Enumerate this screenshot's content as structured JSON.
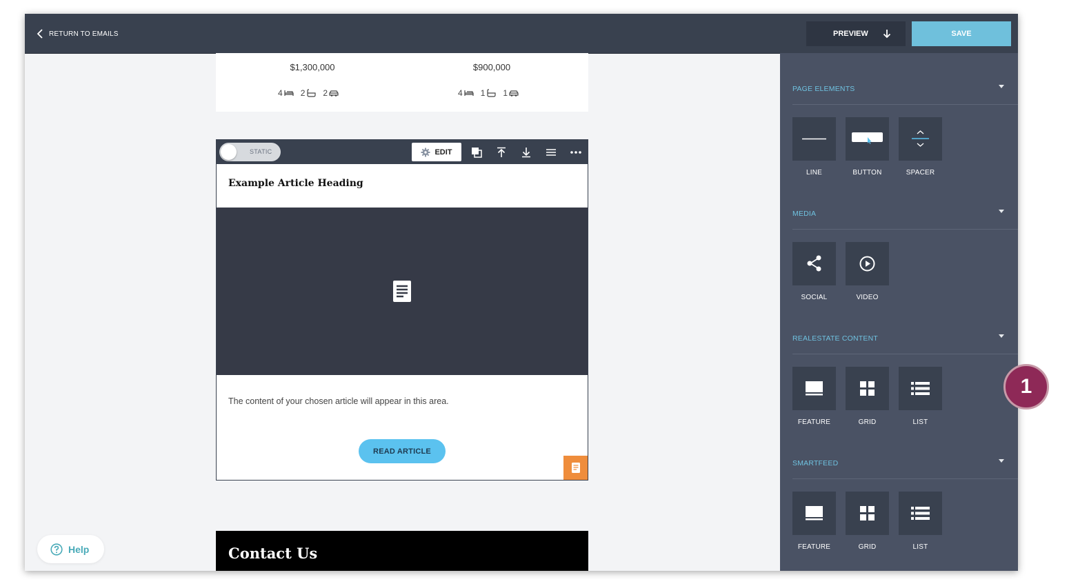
{
  "topbar": {
    "back_label": "RETURN TO EMAILS",
    "preview_label": "PREVIEW",
    "save_label": "SAVE"
  },
  "listing": {
    "left": {
      "price": "$1,300,000",
      "beds": "4",
      "baths": "2",
      "garage": "2"
    },
    "right": {
      "price": "$900,000",
      "beds": "4",
      "baths": "1",
      "garage": "1"
    }
  },
  "article_block": {
    "toggle_label": "STATIC",
    "edit_label": "EDIT",
    "heading": "Example Article Heading",
    "body_text": "The content of your chosen article will appear in this area.",
    "button_label": "READ ARTICLE"
  },
  "contact": {
    "title": "Contact Us"
  },
  "help": {
    "label": "Help"
  },
  "sidebar": {
    "sections": [
      {
        "title": "PAGE ELEMENTS",
        "items": [
          "LINE",
          "BUTTON",
          "SPACER"
        ]
      },
      {
        "title": "MEDIA",
        "items": [
          "SOCIAL",
          "VIDEO"
        ]
      },
      {
        "title": "REALESTATE CONTENT",
        "items": [
          "FEATURE",
          "GRID",
          "LIST"
        ]
      },
      {
        "title": "SMARTFEED",
        "items": [
          "FEATURE",
          "GRID",
          "LIST"
        ]
      }
    ]
  },
  "badge": {
    "number": "1"
  },
  "colors": {
    "topbar": "#39414f",
    "sidebar": "#4a5264",
    "accent": "#6fc0dc",
    "read_button": "#5bc2ef",
    "tag": "#ef8d3c",
    "badge": "#8e2957"
  }
}
